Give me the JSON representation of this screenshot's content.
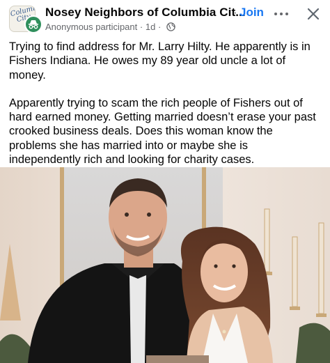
{
  "post": {
    "group_name": "Nosey Neighbors of Columbia Cit...",
    "join_label": "Join",
    "group_logo_text": "Columbia City",
    "author": "Anonymous participant",
    "separator": "·",
    "time": "1d",
    "privacy_icon": "globe-icon",
    "paragraphs": [
      "Trying to find address for Mr. Larry Hilty. He apparently is in Fishers Indiana.  He owes my 89 year old uncle a lot of money.",
      "Apparently trying to scam the rich people of Fishers out of hard earned money.  Getting married doesn’t erase your past crooked business deals.  Does this woman know the problems she has married into or maybe she is independently rich and looking for charity cases."
    ]
  },
  "icons": {
    "more": "more-options-icon",
    "close": "close-icon",
    "anonymous": "anonymous-icon"
  },
  "colors": {
    "join": "#1877f2",
    "secondary_text": "#65676b",
    "anonymous_badge": "#2f8f5c"
  }
}
